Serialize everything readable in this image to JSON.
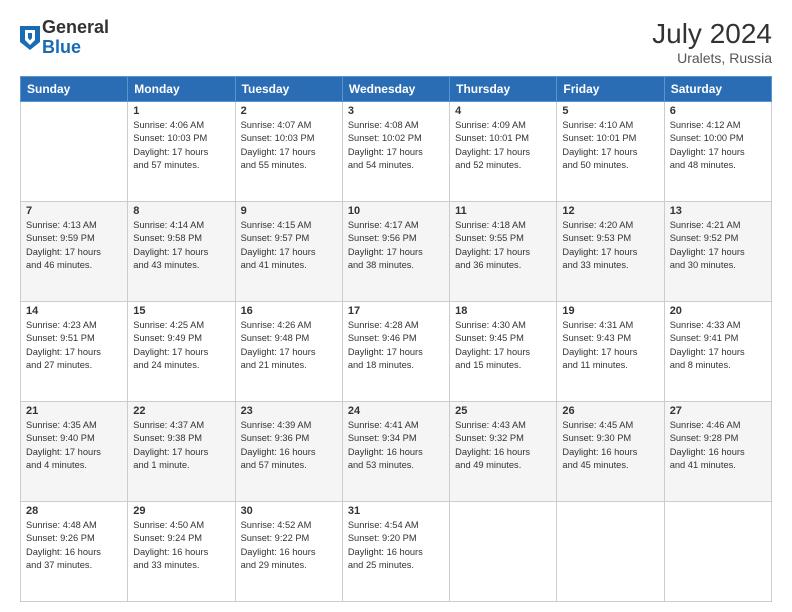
{
  "header": {
    "logo_general": "General",
    "logo_blue": "Blue",
    "month_year": "July 2024",
    "location": "Uralets, Russia"
  },
  "days_of_week": [
    "Sunday",
    "Monday",
    "Tuesday",
    "Wednesday",
    "Thursday",
    "Friday",
    "Saturday"
  ],
  "weeks": [
    [
      {
        "day": "",
        "info": ""
      },
      {
        "day": "1",
        "info": "Sunrise: 4:06 AM\nSunset: 10:03 PM\nDaylight: 17 hours\nand 57 minutes."
      },
      {
        "day": "2",
        "info": "Sunrise: 4:07 AM\nSunset: 10:03 PM\nDaylight: 17 hours\nand 55 minutes."
      },
      {
        "day": "3",
        "info": "Sunrise: 4:08 AM\nSunset: 10:02 PM\nDaylight: 17 hours\nand 54 minutes."
      },
      {
        "day": "4",
        "info": "Sunrise: 4:09 AM\nSunset: 10:01 PM\nDaylight: 17 hours\nand 52 minutes."
      },
      {
        "day": "5",
        "info": "Sunrise: 4:10 AM\nSunset: 10:01 PM\nDaylight: 17 hours\nand 50 minutes."
      },
      {
        "day": "6",
        "info": "Sunrise: 4:12 AM\nSunset: 10:00 PM\nDaylight: 17 hours\nand 48 minutes."
      }
    ],
    [
      {
        "day": "7",
        "info": "Sunrise: 4:13 AM\nSunset: 9:59 PM\nDaylight: 17 hours\nand 46 minutes."
      },
      {
        "day": "8",
        "info": "Sunrise: 4:14 AM\nSunset: 9:58 PM\nDaylight: 17 hours\nand 43 minutes."
      },
      {
        "day": "9",
        "info": "Sunrise: 4:15 AM\nSunset: 9:57 PM\nDaylight: 17 hours\nand 41 minutes."
      },
      {
        "day": "10",
        "info": "Sunrise: 4:17 AM\nSunset: 9:56 PM\nDaylight: 17 hours\nand 38 minutes."
      },
      {
        "day": "11",
        "info": "Sunrise: 4:18 AM\nSunset: 9:55 PM\nDaylight: 17 hours\nand 36 minutes."
      },
      {
        "day": "12",
        "info": "Sunrise: 4:20 AM\nSunset: 9:53 PM\nDaylight: 17 hours\nand 33 minutes."
      },
      {
        "day": "13",
        "info": "Sunrise: 4:21 AM\nSunset: 9:52 PM\nDaylight: 17 hours\nand 30 minutes."
      }
    ],
    [
      {
        "day": "14",
        "info": "Sunrise: 4:23 AM\nSunset: 9:51 PM\nDaylight: 17 hours\nand 27 minutes."
      },
      {
        "day": "15",
        "info": "Sunrise: 4:25 AM\nSunset: 9:49 PM\nDaylight: 17 hours\nand 24 minutes."
      },
      {
        "day": "16",
        "info": "Sunrise: 4:26 AM\nSunset: 9:48 PM\nDaylight: 17 hours\nand 21 minutes."
      },
      {
        "day": "17",
        "info": "Sunrise: 4:28 AM\nSunset: 9:46 PM\nDaylight: 17 hours\nand 18 minutes."
      },
      {
        "day": "18",
        "info": "Sunrise: 4:30 AM\nSunset: 9:45 PM\nDaylight: 17 hours\nand 15 minutes."
      },
      {
        "day": "19",
        "info": "Sunrise: 4:31 AM\nSunset: 9:43 PM\nDaylight: 17 hours\nand 11 minutes."
      },
      {
        "day": "20",
        "info": "Sunrise: 4:33 AM\nSunset: 9:41 PM\nDaylight: 17 hours\nand 8 minutes."
      }
    ],
    [
      {
        "day": "21",
        "info": "Sunrise: 4:35 AM\nSunset: 9:40 PM\nDaylight: 17 hours\nand 4 minutes."
      },
      {
        "day": "22",
        "info": "Sunrise: 4:37 AM\nSunset: 9:38 PM\nDaylight: 17 hours\nand 1 minute."
      },
      {
        "day": "23",
        "info": "Sunrise: 4:39 AM\nSunset: 9:36 PM\nDaylight: 16 hours\nand 57 minutes."
      },
      {
        "day": "24",
        "info": "Sunrise: 4:41 AM\nSunset: 9:34 PM\nDaylight: 16 hours\nand 53 minutes."
      },
      {
        "day": "25",
        "info": "Sunrise: 4:43 AM\nSunset: 9:32 PM\nDaylight: 16 hours\nand 49 minutes."
      },
      {
        "day": "26",
        "info": "Sunrise: 4:45 AM\nSunset: 9:30 PM\nDaylight: 16 hours\nand 45 minutes."
      },
      {
        "day": "27",
        "info": "Sunrise: 4:46 AM\nSunset: 9:28 PM\nDaylight: 16 hours\nand 41 minutes."
      }
    ],
    [
      {
        "day": "28",
        "info": "Sunrise: 4:48 AM\nSunset: 9:26 PM\nDaylight: 16 hours\nand 37 minutes."
      },
      {
        "day": "29",
        "info": "Sunrise: 4:50 AM\nSunset: 9:24 PM\nDaylight: 16 hours\nand 33 minutes."
      },
      {
        "day": "30",
        "info": "Sunrise: 4:52 AM\nSunset: 9:22 PM\nDaylight: 16 hours\nand 29 minutes."
      },
      {
        "day": "31",
        "info": "Sunrise: 4:54 AM\nSunset: 9:20 PM\nDaylight: 16 hours\nand 25 minutes."
      },
      {
        "day": "",
        "info": ""
      },
      {
        "day": "",
        "info": ""
      },
      {
        "day": "",
        "info": ""
      }
    ]
  ]
}
